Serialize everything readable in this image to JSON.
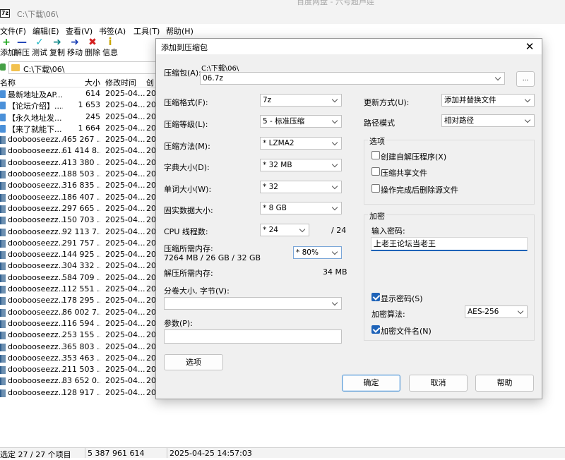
{
  "fm": {
    "title": "C:\\下载\\06\\",
    "app_icon": "7z",
    "ghost_title": "百度网盘 - 六号超芦娃",
    "menus": [
      "文件(F)",
      "编辑(E)",
      "查看(V)",
      "书签(A)",
      "工具(T)",
      "帮助(H)"
    ],
    "toolbar": [
      {
        "label": "添加",
        "icon": "+",
        "color": "#19a619"
      },
      {
        "label": "解压",
        "icon": "—",
        "color": "#1a3fb5"
      },
      {
        "label": "测试",
        "icon": "✓",
        "color": "#1fb8c4"
      },
      {
        "label": "复制",
        "icon": "➜",
        "color": "#148a8a"
      },
      {
        "label": "移动",
        "icon": "➜",
        "color": "#1a3fb5"
      },
      {
        "label": "删除",
        "icon": "✖",
        "color": "#d42020"
      },
      {
        "label": "信息",
        "icon": "i",
        "color": "#c9a500"
      }
    ],
    "address": "C:\\下载\\06\\",
    "columns": [
      "名称",
      "大小",
      "修改时间",
      "创"
    ],
    "rows": [
      {
        "name": "最新地址及AP...",
        "size": "614",
        "date": "2025-04...",
        "extra": "20",
        "icon": "doc"
      },
      {
        "name": "【论坛介绍】....",
        "size": "1 653",
        "date": "2025-04...",
        "extra": "20",
        "icon": "doc"
      },
      {
        "name": "【永久地址发...",
        "size": "245",
        "date": "2025-04...",
        "extra": "20",
        "icon": "doc"
      },
      {
        "name": "【来了就能下...",
        "size": "1 664",
        "date": "2025-04...",
        "extra": "20",
        "icon": "doc"
      },
      {
        "name": "doobooseezz...",
        "size": "465 267 ...",
        "date": "2025-04...",
        "extra": "20",
        "icon": "arc"
      },
      {
        "name": "doobooseezz...",
        "size": "61 414 8...",
        "date": "2025-04...",
        "extra": "20",
        "icon": "arc"
      },
      {
        "name": "doobooseezz...",
        "size": "413 380 ...",
        "date": "2025-04...",
        "extra": "20",
        "icon": "arc"
      },
      {
        "name": "doobooseezz...",
        "size": "188 503 ...",
        "date": "2025-04...",
        "extra": "20",
        "icon": "arc"
      },
      {
        "name": "doobooseezz...",
        "size": "316 835 ...",
        "date": "2025-04...",
        "extra": "20",
        "icon": "arc"
      },
      {
        "name": "doobooseezz...",
        "size": "186 407 ...",
        "date": "2025-04...",
        "extra": "20",
        "icon": "arc"
      },
      {
        "name": "doobooseezz...",
        "size": "297 665 ...",
        "date": "2025-04...",
        "extra": "20",
        "icon": "arc"
      },
      {
        "name": "doobooseezz...",
        "size": "150 703 ...",
        "date": "2025-04...",
        "extra": "20",
        "icon": "arc"
      },
      {
        "name": "doobooseezz...",
        "size": "92 113 7...",
        "date": "2025-04...",
        "extra": "20",
        "icon": "arc"
      },
      {
        "name": "doobooseezz...",
        "size": "291 757 ...",
        "date": "2025-04...",
        "extra": "20",
        "icon": "arc"
      },
      {
        "name": "doobooseezz...",
        "size": "144 925 ...",
        "date": "2025-04...",
        "extra": "20",
        "icon": "arc"
      },
      {
        "name": "doobooseezz...",
        "size": "304 332 ...",
        "date": "2025-04...",
        "extra": "20",
        "icon": "arc"
      },
      {
        "name": "doobooseezz...",
        "size": "584 709 ...",
        "date": "2025-04...",
        "extra": "20",
        "icon": "arc"
      },
      {
        "name": "doobooseezz...",
        "size": "112 551 ...",
        "date": "2025-04...",
        "extra": "20",
        "icon": "arc"
      },
      {
        "name": "doobooseezz...",
        "size": "178 295 ...",
        "date": "2025-04...",
        "extra": "20",
        "icon": "arc"
      },
      {
        "name": "doobooseezz...",
        "size": "86 002 7...",
        "date": "2025-04...",
        "extra": "20",
        "icon": "arc"
      },
      {
        "name": "doobooseezz...",
        "size": "116 594 ...",
        "date": "2025-04...",
        "extra": "20",
        "icon": "arc"
      },
      {
        "name": "doobooseezz...",
        "size": "253 155 ...",
        "date": "2025-04...",
        "extra": "20",
        "icon": "arc"
      },
      {
        "name": "doobooseezz...",
        "size": "365 803 ...",
        "date": "2025-04...",
        "extra": "20",
        "icon": "arc"
      },
      {
        "name": "doobooseezz...",
        "size": "353 463 ...",
        "date": "2025-04...",
        "extra": "20",
        "icon": "arc"
      },
      {
        "name": "doobooseezz...",
        "size": "211 503 ...",
        "date": "2025-04...",
        "extra": "20",
        "icon": "arc"
      },
      {
        "name": "doobooseezz...",
        "size": "83 652 0...",
        "date": "2025-04...",
        "extra": "20",
        "icon": "arc"
      },
      {
        "name": "doobooseezz...",
        "size": "128 917 ...",
        "date": "2025-04...",
        "extra": "20",
        "icon": "arc"
      }
    ],
    "status": {
      "selected": "选定 27 / 27 个项目",
      "total_size": "5 387 961 614",
      "selected_size": "614",
      "datetime": "2025-04-25 14:57:03"
    }
  },
  "dialog": {
    "title": "添加到压缩包",
    "close_icon": "✕",
    "archive_label": "压缩包(A):",
    "archive_dir": "C:\\下载\\06\\",
    "archive_name": "06.7z",
    "browse_label": "...",
    "format": {
      "label": "压缩格式(F):",
      "value": "7z"
    },
    "level": {
      "label": "压缩等级(L):",
      "value": "5 - 标准压缩"
    },
    "method": {
      "label": "压缩方法(M):",
      "value": "*  LZMA2"
    },
    "dict": {
      "label": "字典大小(D):",
      "value": "*  32 MB"
    },
    "word": {
      "label": "单词大小(W):",
      "value": "*  32"
    },
    "solid": {
      "label": "固实数据大小:",
      "value": "*  8 GB"
    },
    "threads": {
      "label": "CPU 线程数:",
      "value": "*  24",
      "max": "/ 24"
    },
    "mem_compress": {
      "label": "压缩所需内存:",
      "detail": "7264 MB / 26 GB / 32 GB",
      "value": "*  80%"
    },
    "mem_decompress": {
      "label": "解压所需内存:",
      "value": "34 MB"
    },
    "volume": {
      "label": "分卷大小, 字节(V):",
      "value": ""
    },
    "params": {
      "label": "参数(P):",
      "value": ""
    },
    "options_button": "选项",
    "update": {
      "label": "更新方式(U):",
      "value": "添加并替换文件"
    },
    "path_mode": {
      "label": "路径模式",
      "value": "相对路径"
    },
    "options_group": {
      "title": "选项",
      "sfx": {
        "label": "创建自解压程序(X)",
        "checked": false
      },
      "shared": {
        "label": "压缩共享文件",
        "checked": false
      },
      "delete_after": {
        "label": "操作完成后删除源文件",
        "checked": false
      }
    },
    "encryption": {
      "title": "加密",
      "password_label": "输入密码:",
      "password": "上老王论坛当老王",
      "show_password": {
        "label": "显示密码(S)",
        "checked": true
      },
      "method_label": "加密算法:",
      "method_value": "AES-256",
      "encrypt_names": {
        "label": "加密文件名(N)",
        "checked": true
      }
    },
    "ok": "确定",
    "cancel": "取消",
    "help": "帮助"
  }
}
